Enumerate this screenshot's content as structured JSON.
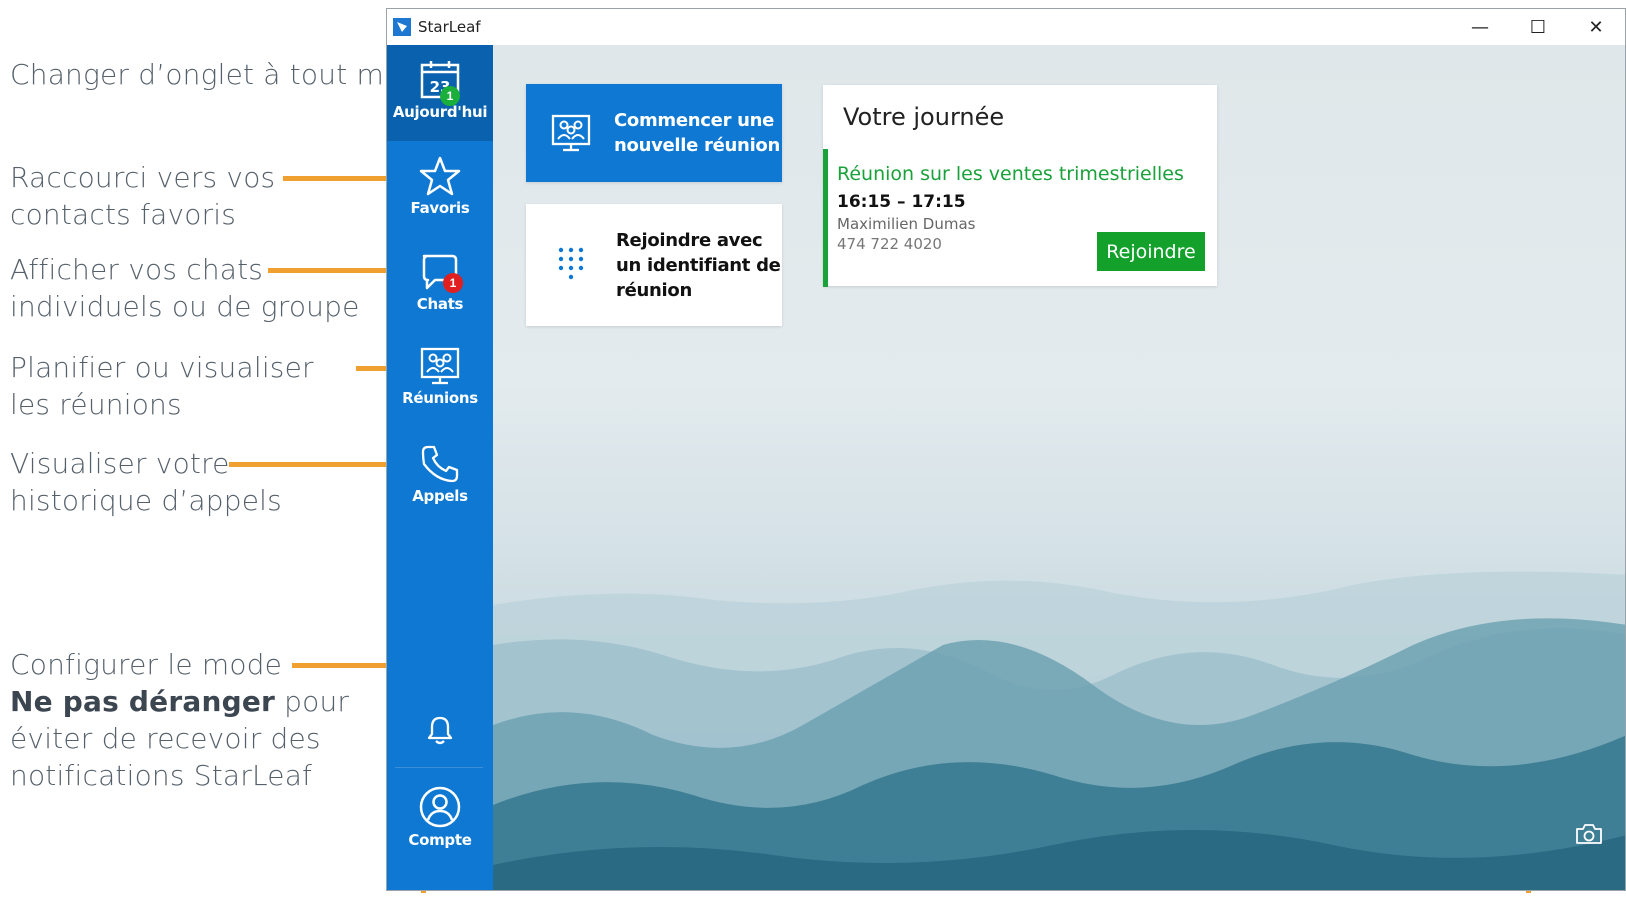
{
  "annotations": {
    "tabs_heading": "Changer d’onglet à tout moment:",
    "favoris": "Raccourci vers vos contacts favoris",
    "chats": "Afficher vos chats individuels ou de groupe",
    "reunions": "Planifier ou visualiser les réunions",
    "appels": "Visualiser votre historique d’appels",
    "dnd_prefix": "Configurer le mode",
    "dnd_bold": "Ne pas déranger",
    "dnd_suffix_1": "pour",
    "dnd_line_3": "éviter de recevoir des",
    "dnd_line_4": "notifications StarLeaf"
  },
  "window": {
    "title": "StarLeaf",
    "minimize": "—",
    "maximize": "☐",
    "close": "✕"
  },
  "sidebar": {
    "items": [
      {
        "label": "Aujourd'hui",
        "icon": "calendar-icon",
        "calendar_day": "23",
        "badge": "1",
        "badge_color": "#1aae3a",
        "active": true
      },
      {
        "label": "Favoris",
        "icon": "star-icon"
      },
      {
        "label": "Chats",
        "icon": "chat-icon",
        "badge": "1",
        "badge_color": "#e02020"
      },
      {
        "label": "Réunions",
        "icon": "meeting-room-icon"
      },
      {
        "label": "Appels",
        "icon": "phone-icon"
      },
      {
        "label": "",
        "icon": "bell-icon"
      },
      {
        "label": "Compte",
        "icon": "account-icon"
      }
    ]
  },
  "main": {
    "start_meeting": {
      "line1": "Commencer une",
      "line2": "nouvelle réunion",
      "icon": "meeting-room-icon"
    },
    "join_with_id": {
      "line1": "Rejoindre avec",
      "line2": "un identifiant de",
      "line3": "réunion",
      "icon": "dialpad-icon"
    },
    "day": {
      "title": "Votre journée",
      "meeting_title": "Réunion sur les ventes trimestrielles",
      "time": "16:15 – 17:15",
      "organizer": "Maximilien Dumas",
      "number": "474 722 4020",
      "join_label": "Rejoindre"
    },
    "camera_icon": "camera-icon"
  },
  "colors": {
    "sidebar": "#0f78d2",
    "sidebar_active": "#0a61ad",
    "accent_green": "#1aa23a",
    "leader": "#f0a030"
  }
}
